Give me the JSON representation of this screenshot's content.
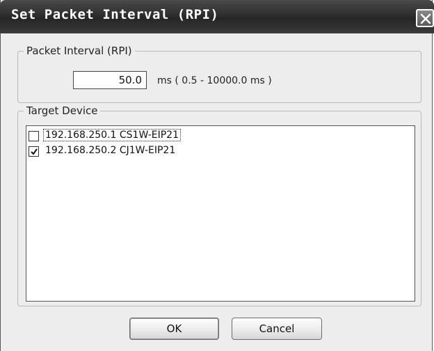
{
  "dialog": {
    "title": "Set Packet Interval (RPI)",
    "close_icon": "close-icon"
  },
  "rpi": {
    "group_label": "Packet Interval (RPI)",
    "value": "50.0",
    "unit_range": "ms ( 0.5 - 10000.0 ms )"
  },
  "target": {
    "group_label": "Target Device",
    "devices": [
      {
        "label": "192.168.250.1 CS1W-EIP21",
        "checked": false
      },
      {
        "label": "192.168.250.2 CJ1W-EIP21",
        "checked": true
      }
    ]
  },
  "buttons": {
    "ok": "OK",
    "cancel": "Cancel"
  }
}
